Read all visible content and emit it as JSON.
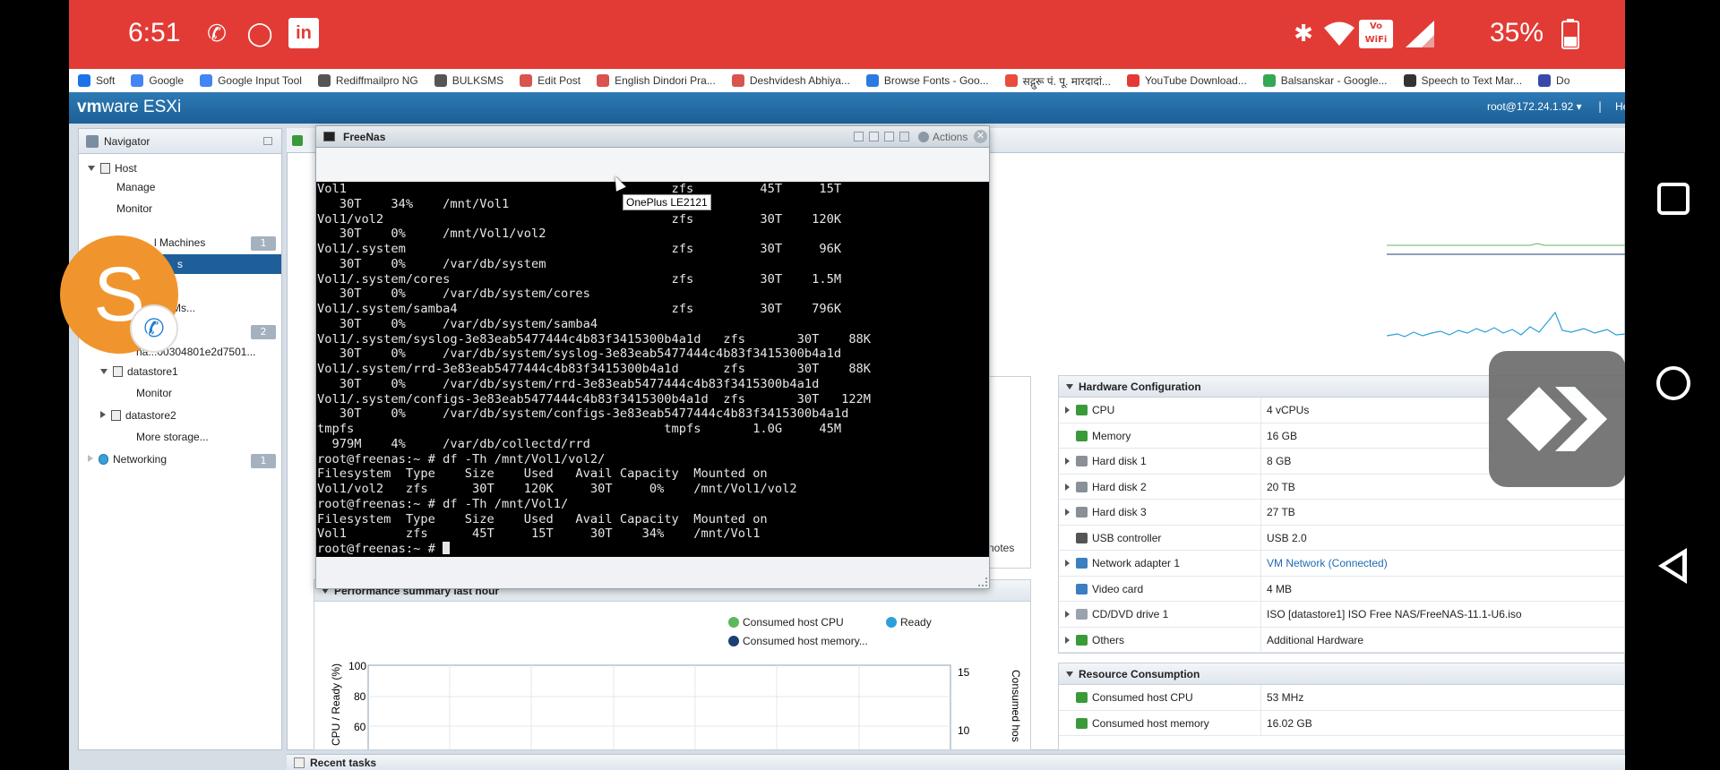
{
  "statusbar": {
    "time": "6:51",
    "battery": "35%",
    "volte_top": "Vo",
    "volte_bottom": "WiFi",
    "linkedin": "in"
  },
  "bookmarks": [
    {
      "label": "Soft",
      "color": "#1a73e8"
    },
    {
      "label": "Google",
      "color": "#4285f4"
    },
    {
      "label": "Google Input Tool",
      "color": "#4285f4"
    },
    {
      "label": "Rediffmailpro NG",
      "color": "#555555"
    },
    {
      "label": "BULKSMS",
      "color": "#555555"
    },
    {
      "label": "Edit Post",
      "color": "#d9534f"
    },
    {
      "label": "English Dindori Pra...",
      "color": "#d9534f"
    },
    {
      "label": "Deshvidesh Abhiya...",
      "color": "#d9534f"
    },
    {
      "label": "Browse Fonts - Goo...",
      "color": "#2a7ae2"
    },
    {
      "label": "सद्गुरू पं. पू. मारदादां...",
      "color": "#e74c3c"
    },
    {
      "label": "YouTube Download...",
      "color": "#e53935"
    },
    {
      "label": "Balsanskar - Google...",
      "color": "#34a853"
    },
    {
      "label": "Speech to Text Mar...",
      "color": "#333333"
    },
    {
      "label": "Do",
      "color": "#3949ab"
    }
  ],
  "esxi": {
    "logo_vm": "vm",
    "logo_rest": "ware",
    "logo_product": " ESXi",
    "user": "root@172.24.1.92 ▾",
    "separator": "|",
    "help": "He"
  },
  "navigator": {
    "title": "Navigator",
    "host": "Host",
    "manage": "Manage",
    "monitor": "Monitor",
    "vms": "l Machines",
    "vms_badge": "1",
    "vms_child": "s",
    "more_vms": "Ms...",
    "storage_badge": "2",
    "storage_item": "na...00304801e2d7501...",
    "datastore1": "datastore1",
    "ds1_monitor": "Monitor",
    "datastore2": "datastore2",
    "more_storage": "More storage...",
    "networking": "Networking",
    "networking_badge": "1"
  },
  "console": {
    "title": "FreeNas",
    "actions": "Actions",
    "close": "✕",
    "tooltip": "OnePlus LE2121",
    "lines": [
      "Vol1                                            zfs         45T     15T",
      "   30T    34%    /mnt/Vol1",
      "Vol1/vol2                                       zfs         30T    120K",
      "   30T    0%     /mnt/Vol1/vol2",
      "Vol1/.system                                    zfs         30T     96K",
      "   30T    0%     /var/db/system",
      "Vol1/.system/cores                              zfs         30T    1.5M",
      "   30T    0%     /var/db/system/cores",
      "Vol1/.system/samba4                             zfs         30T    796K",
      "   30T    0%     /var/db/system/samba4",
      "Vol1/.system/syslog-3e83eab5477444c4b83f3415300b4a1d   zfs       30T    88K",
      "   30T    0%     /var/db/system/syslog-3e83eab5477444c4b83f3415300b4a1d",
      "Vol1/.system/rrd-3e83eab5477444c4b83f3415300b4a1d      zfs       30T    88K",
      "   30T    0%     /var/db/system/rrd-3e83eab5477444c4b83f3415300b4a1d",
      "Vol1/.system/configs-3e83eab5477444c4b83f3415300b4a1d  zfs       30T   122M",
      "   30T    0%     /var/db/system/configs-3e83eab5477444c4b83f3415300b4a1d",
      "tmpfs                                          tmpfs       1.0G     45M",
      "  979M    4%     /var/db/collectd/rrd",
      "root@freenas:~ # df -Th /mnt/Vol1/vol2/",
      "Filesystem  Type    Size    Used   Avail Capacity  Mounted on",
      "Vol1/vol2   zfs      30T    120K     30T     0%    /mnt/Vol1/vol2",
      "root@freenas:~ # df -Th /mnt/Vol1/",
      "Filesystem  Type    Size    Used   Avail Capacity  Mounted on",
      "Vol1        zfs      45T     15T     30T    34%    /mnt/Vol1"
    ],
    "prompt": "root@freenas:~ # "
  },
  "notes": "notes",
  "performance": {
    "title": "Performance summary last hour",
    "legend_cpu": "Consumed host CPU",
    "legend_ready": "Ready",
    "legend_memory": "Consumed host memory...",
    "color_cpu": "#5cb85c",
    "color_ready": "#2b9fd9",
    "color_memory": "#1d3f73",
    "ylabel_left": "CPU / Ready (%)",
    "ylabel_right": "Consumed hos",
    "yticks_left": [
      "100",
      "80",
      "60"
    ],
    "yticks_right": [
      "15",
      "10"
    ]
  },
  "hardware": {
    "title": "Hardware Configuration",
    "rows": [
      {
        "name": "CPU",
        "value": "4 vCPUs",
        "expand": true,
        "icon": "cpu-icon",
        "color": "#3a9a3a",
        "link": false
      },
      {
        "name": "Memory",
        "value": "16 GB",
        "expand": false,
        "icon": "memory-icon",
        "color": "#3a9a3a",
        "link": false
      },
      {
        "name": "Hard disk 1",
        "value": "8 GB",
        "expand": true,
        "icon": "hard-disk-icon",
        "color": "#8a9098",
        "link": false
      },
      {
        "name": "Hard disk 2",
        "value": "20 TB",
        "expand": true,
        "icon": "hard-disk-icon",
        "color": "#8a9098",
        "link": false
      },
      {
        "name": "Hard disk 3",
        "value": "27 TB",
        "expand": true,
        "icon": "hard-disk-icon",
        "color": "#8a9098",
        "link": false
      },
      {
        "name": "USB controller",
        "value": "USB 2.0",
        "expand": false,
        "icon": "usb-icon",
        "color": "#555555",
        "link": false
      },
      {
        "name": "Network adapter 1",
        "value": "VM Network (Connected)",
        "expand": true,
        "icon": "network-adapter-icon",
        "color": "#3a7fc0",
        "link": true
      },
      {
        "name": "Video card",
        "value": "4 MB",
        "expand": false,
        "icon": "video-card-icon",
        "color": "#3a7fc0",
        "link": false
      },
      {
        "name": "CD/DVD drive 1",
        "value": "ISO [datastore1] ISO Free NAS/FreeNAS-11.1-U6.iso",
        "expand": true,
        "icon": "cd-dvd-icon",
        "color": "#9aa2ab",
        "link": false
      },
      {
        "name": "Others",
        "value": "Additional Hardware",
        "expand": true,
        "icon": "others-icon",
        "color": "#3a9a3a",
        "link": false
      }
    ]
  },
  "resources": {
    "title": "Resource Consumption",
    "rows": [
      {
        "name": "Consumed host CPU",
        "value": "53 MHz",
        "icon": "cpu-icon",
        "color": "#3a9a3a"
      },
      {
        "name": "Consumed host memory",
        "value": "16.02 GB",
        "icon": "memory-icon",
        "color": "#3a9a3a"
      }
    ]
  },
  "recent_tasks": "Recent tasks",
  "call_bubble": {
    "letter": "S",
    "phone_glyph": "✆"
  }
}
